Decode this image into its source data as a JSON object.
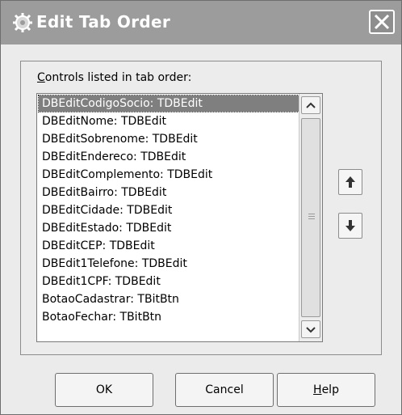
{
  "window": {
    "title": "Edit Tab Order",
    "icon": "gear-icon"
  },
  "group": {
    "label_mnemonic": "C",
    "label_rest": "ontrols listed in tab order:"
  },
  "list": {
    "items": [
      "DBEditCodigoSocio: TDBEdit",
      "DBEditNome: TDBEdit",
      "DBEditSobrenome: TDBEdit",
      "DBEditEndereco: TDBEdit",
      "DBEditComplemento: TDBEdit",
      "DBEditBairro: TDBEdit",
      "DBEditCidade: TDBEdit",
      "DBEditEstado: TDBEdit",
      "DBEditCEP: TDBEdit",
      "DBEdit1Telefone: TDBEdit",
      "DBEdit1CPF: TDBEdit",
      "BotaoCadastrar: TBitBtn",
      "BotaoFechar: TBitBtn"
    ],
    "selected_index": 0
  },
  "buttons": {
    "ok": "OK",
    "cancel": "Cancel",
    "help_mnemonic": "H",
    "help_rest": "elp"
  },
  "icons": {
    "move_up": "arrow-up-icon",
    "move_down": "arrow-down-icon",
    "close": "close-icon"
  }
}
